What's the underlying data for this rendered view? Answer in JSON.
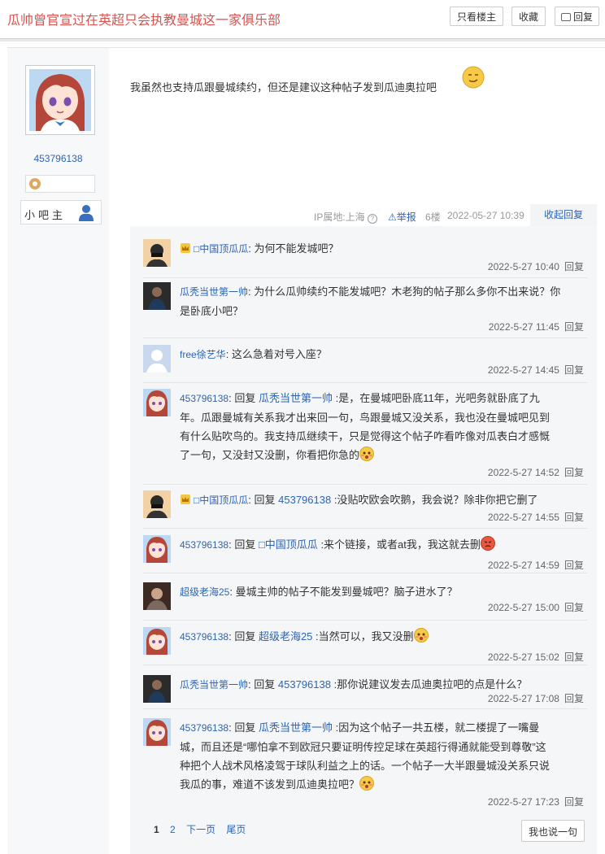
{
  "header": {
    "title": "瓜帅曾官宣过在英超只会执教曼城这一家俱乐部",
    "only_op_label": "只看楼主",
    "favorite_label": "收藏",
    "reply_label": "回复"
  },
  "author": {
    "username": "453796138",
    "badge": "小吧主"
  },
  "post": {
    "text": "我虽然也支持瓜跟曼城续约，但还是建议这种帖子发到瓜迪奥拉吧",
    "ip": "IP属地:上海",
    "report": "举报",
    "floor": "6楼",
    "time": "2022-05-27 10:39",
    "collapse": "收起回复"
  },
  "comments": [
    {
      "user": "□中国顶瓜瓜",
      "text": "为何不能发城吧？",
      "time": "2022-5-27 10:40",
      "reply": "回复"
    },
    {
      "user": "瓜秃当世第一帅",
      "text_l1": "为什么瓜帅续约不能发城吧？木老狗的帖子那么多你不出来说？你",
      "text_l2": "是卧底小吧？",
      "time": "2022-5-27 11:45",
      "reply": "回复"
    },
    {
      "user": "free徐艺华",
      "text": "这么急着对号入座？",
      "time": "2022-5-27 14:45",
      "reply": "回复"
    },
    {
      "user": "453796138",
      "reply_word": "回复",
      "target": "瓜秃当世第一帅",
      "text_l1": ":是，在曼城吧卧底11年，光吧务就卧底了九",
      "text_l2": "年。瓜跟曼城有关系我才出来回一句，鸟跟曼城又没关系，我也没在曼城吧见到",
      "text_l3": "有什么贴吹鸟的。我支持瓜继续干，只是觉得这个帖子咋看咋像对瓜表白才感慨",
      "text_l4": "了一句，又没封又没删，你看把你急的",
      "time": "2022-5-27 14:52",
      "reply": "回复"
    },
    {
      "user": "□中国顶瓜瓜",
      "reply_word": "回复",
      "target": "453796138",
      "text": ":没贴吹欧会吹鹅，我会说？除非你把它删了",
      "time": "2022-5-27 14:55",
      "reply": "回复"
    },
    {
      "user": "453796138",
      "reply_word": "回复",
      "target": "□中国顶瓜瓜",
      "text": ":来个链接，或者at我，我这就去删",
      "time": "2022-5-27 14:59",
      "reply": "回复"
    },
    {
      "user": "超级老海25",
      "text": "曼城主帅的帖子不能发到曼城吧？脑子进水了？",
      "time": "2022-5-27 15:00",
      "reply": "回复"
    },
    {
      "user": "453796138",
      "reply_word": "回复",
      "target": "超级老海25",
      "text": ":当然可以，我又没删",
      "time": "2022-5-27 15:02",
      "reply": "回复"
    },
    {
      "user": "瓜秃当世第一帅",
      "reply_word": "回复",
      "target": "453796138",
      "text": ":那你说建议发去瓜迪奥拉吧的点是什么？",
      "time": "2022-5-27 17:08",
      "reply": "回复"
    },
    {
      "user": "453796138",
      "reply_word": "回复",
      "target": "瓜秃当世第一帅",
      "text_l1": ":因为这个帖子一共五楼，就二楼提了一嘴曼",
      "text_l2": "城，而且还是“哪怕拿不到欧冠只要证明传控足球在英超行得通就能受到尊敬”这",
      "text_l3": "种把个人战术风格凌驾于球队利益之上的话。一个帖子一大半跟曼城没关系只说",
      "text_l4": "我瓜的事，难道不该发到瓜迪奥拉吧？",
      "time": "2022-5-27 17:23",
      "reply": "回复"
    }
  ],
  "pager": {
    "p1": "1",
    "p2": "2",
    "next": "下一页",
    "last": "尾页"
  },
  "say_button": "我也说一句",
  "colors": {
    "title": "#d9534f",
    "link": "#2d64b3",
    "panel": "#f5f6f8"
  }
}
